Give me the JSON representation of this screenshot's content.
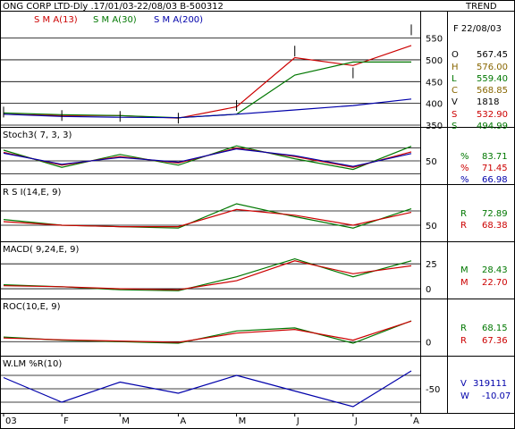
{
  "header": {
    "title": "ONG CORP LTD-Dly .17/01/03-22/08/03  B-500312",
    "trend_label": "TREND",
    "date_label": "F 22/08/03"
  },
  "price_panel": {
    "legend": [
      {
        "label": "S M A(13)",
        "color": "#cc0000"
      },
      {
        "label": "S M A(30)",
        "color": "#007700"
      },
      {
        "label": "S M A(200)",
        "color": "#0000aa"
      }
    ],
    "y_ticks": [
      "550",
      "500",
      "450",
      "400",
      "350"
    ],
    "readout": [
      {
        "key": "O",
        "value": "567.45",
        "color": "#000000"
      },
      {
        "key": "H",
        "value": "576.00",
        "color": "#886600"
      },
      {
        "key": "L",
        "value": "559.40",
        "color": "#007700"
      },
      {
        "key": "C",
        "value": "568.85",
        "color": "#886600"
      },
      {
        "key": "V",
        "value": "1818",
        "color": "#000000"
      },
      {
        "key": "S",
        "value": "532.90",
        "color": "#cc0000"
      },
      {
        "key": "S",
        "value": "494.99",
        "color": "#007700"
      }
    ]
  },
  "stoch_panel": {
    "label": "Stoch3( 7, 3, 3)",
    "y_ticks": [
      "50"
    ],
    "readout": [
      {
        "key": "%",
        "value": "83.71",
        "color": "#007700"
      },
      {
        "key": "%",
        "value": "71.45",
        "color": "#cc0000"
      },
      {
        "key": "%",
        "value": "66.98",
        "color": "#0000aa"
      }
    ]
  },
  "rsi_panel": {
    "label": "R S I(14,E, 9)",
    "y_ticks": [
      "50"
    ],
    "readout": [
      {
        "key": "R",
        "value": "72.89",
        "color": "#007700"
      },
      {
        "key": "R",
        "value": "68.38",
        "color": "#cc0000"
      }
    ]
  },
  "macd_panel": {
    "label": "MACD( 9,24,E, 9)",
    "y_ticks": [
      "25",
      "0"
    ],
    "readout": [
      {
        "key": "M",
        "value": "28.43",
        "color": "#007700"
      },
      {
        "key": "M",
        "value": "22.70",
        "color": "#cc0000"
      }
    ]
  },
  "roc_panel": {
    "label": "ROC(10,E, 9)",
    "y_ticks": [
      "0"
    ],
    "readout": [
      {
        "key": "R",
        "value": "68.15",
        "color": "#007700"
      },
      {
        "key": "R",
        "value": "67.36",
        "color": "#cc0000"
      }
    ]
  },
  "wlm_panel": {
    "label": "W.LM %R(10)",
    "y_ticks": [
      "-50"
    ],
    "readout": [
      {
        "key": "V",
        "value": "319111",
        "color": "#0000aa"
      },
      {
        "key": "W",
        "value": "-10.07",
        "color": "#0000aa"
      }
    ]
  },
  "x_axis": {
    "labels": [
      "03",
      "F",
      "M",
      "A",
      "M",
      "J",
      "J",
      "A"
    ]
  },
  "chart_data": [
    {
      "type": "line",
      "panel": "price",
      "x": [
        "Jan",
        "Feb",
        "Mar",
        "Apr",
        "May",
        "Jun",
        "Jul",
        "Aug"
      ],
      "series": [
        {
          "name": "S M A(13)",
          "values": [
            375,
            372,
            372,
            366,
            392,
            505,
            487,
            533
          ]
        },
        {
          "name": "S M A(30)",
          "values": [
            378,
            374,
            372,
            367,
            375,
            465,
            495,
            495
          ]
        },
        {
          "name": "S M A(200)",
          "values": [
            375,
            370,
            368,
            367,
            375,
            385,
            395,
            410
          ]
        }
      ],
      "close": [
        380,
        372,
        370,
        366,
        395,
        520,
        470,
        569
      ],
      "ylim": [
        350,
        580
      ],
      "yticks": [
        350,
        400,
        450,
        500,
        550
      ]
    },
    {
      "type": "line",
      "panel": "stochastic",
      "x": [
        "Jan",
        "Feb",
        "Mar",
        "Apr",
        "May",
        "Jun",
        "Jul",
        "Aug"
      ],
      "series": [
        {
          "name": "%K",
          "values": [
            75,
            35,
            65,
            40,
            85,
            55,
            30,
            84
          ]
        },
        {
          "name": "%D",
          "values": [
            70,
            40,
            60,
            45,
            80,
            60,
            35,
            71
          ]
        },
        {
          "name": "%S",
          "values": [
            68,
            42,
            58,
            47,
            78,
            62,
            37,
            67
          ]
        }
      ],
      "ylim": [
        0,
        100
      ],
      "yticks": [
        20,
        50,
        80
      ]
    },
    {
      "type": "line",
      "panel": "rsi",
      "x": [
        "Jan",
        "Feb",
        "Mar",
        "Apr",
        "May",
        "Jun",
        "Jul",
        "Aug"
      ],
      "series": [
        {
          "name": "RSI",
          "values": [
            58,
            50,
            48,
            46,
            80,
            62,
            46,
            73
          ]
        },
        {
          "name": "Signal",
          "values": [
            55,
            50,
            48,
            48,
            72,
            64,
            50,
            68
          ]
        }
      ],
      "ylim": [
        30,
        90
      ],
      "yticks": [
        50,
        70
      ]
    },
    {
      "type": "line",
      "panel": "macd",
      "x": [
        "Jan",
        "Feb",
        "Mar",
        "Apr",
        "May",
        "Jun",
        "Jul",
        "Aug"
      ],
      "series": [
        {
          "name": "MACD",
          "values": [
            4,
            2,
            -1,
            -2,
            12,
            30,
            12,
            28
          ]
        },
        {
          "name": "Signal",
          "values": [
            3,
            2,
            0,
            -1,
            8,
            28,
            15,
            23
          ]
        }
      ],
      "ylim": [
        -8,
        35
      ],
      "yticks": [
        0,
        25
      ]
    },
    {
      "type": "line",
      "panel": "roc",
      "x": [
        "Jan",
        "Feb",
        "Mar",
        "Apr",
        "May",
        "Jun",
        "Jul",
        "Aug"
      ],
      "series": [
        {
          "name": "ROC",
          "values": [
            15,
            5,
            0,
            -5,
            35,
            45,
            -5,
            68
          ]
        },
        {
          "name": "Signal",
          "values": [
            12,
            6,
            2,
            -2,
            28,
            40,
            5,
            67
          ]
        }
      ],
      "ylim": [
        -40,
        100
      ],
      "yticks": [
        0
      ]
    },
    {
      "type": "line",
      "panel": "williams",
      "x": [
        "Jan",
        "Feb",
        "Mar",
        "Apr",
        "May",
        "Jun",
        "Jul",
        "Aug"
      ],
      "series": [
        {
          "name": "%R",
          "values": [
            -25,
            -80,
            -35,
            -60,
            -20,
            -55,
            -90,
            -10
          ]
        }
      ],
      "ylim": [
        -100,
        0
      ],
      "yticks": [
        -20,
        -50,
        -80
      ]
    }
  ]
}
